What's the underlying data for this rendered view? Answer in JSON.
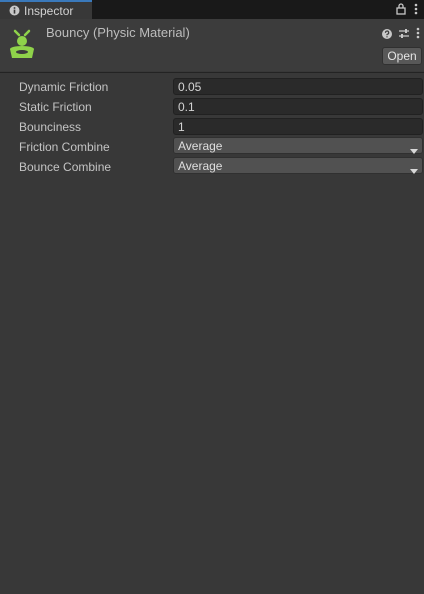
{
  "tab": {
    "label": "Inspector"
  },
  "asset": {
    "title": "Bouncy (Physic Material)"
  },
  "header": {
    "open_label": "Open"
  },
  "properties": [
    {
      "label": "Dynamic Friction",
      "value": "0.05"
    },
    {
      "label": "Static Friction",
      "value": "0.1"
    },
    {
      "label": "Bounciness",
      "value": "1"
    },
    {
      "label": "Friction Combine",
      "value": "Average"
    },
    {
      "label": "Bounce Combine",
      "value": "Average"
    }
  ],
  "colors": {
    "accent_tab": "#3a79bb",
    "icon_green": "#8fd24a",
    "background": "#383838"
  },
  "icons": [
    "info-icon",
    "lock-icon",
    "kebab-menu-icon",
    "physic-material-icon",
    "help-icon",
    "preset-icon",
    "dropdown-arrow-icon"
  ]
}
